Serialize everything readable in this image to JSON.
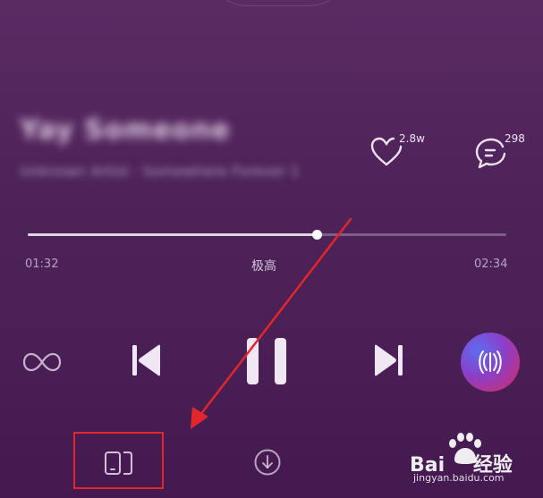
{
  "song": {
    "title": "Yay Someone",
    "artist": "Unknown Artist · Somewhere Forever 1"
  },
  "stats": {
    "likes": "2.8w",
    "comments": "298"
  },
  "progress": {
    "current_time": "01:32",
    "total_time": "02:34",
    "fraction": 0.603,
    "quality_label": "极高"
  },
  "icons": {
    "like": "heart-icon",
    "comment": "comment-bubble-icon",
    "loop": "infinity-loop-icon",
    "prev": "skip-previous-icon",
    "pause": "pause-icon",
    "next": "skip-next-icon",
    "visual": "sound-wave-icon",
    "device": "device-switch-icon",
    "download": "download-icon"
  },
  "colors": {
    "highlight_box": "#e3262b",
    "annotation_arrow": "#e3262b",
    "background": "#4c2258"
  },
  "watermark": {
    "brand": "Bai 经验",
    "url": "jingyan.baidu.com"
  }
}
